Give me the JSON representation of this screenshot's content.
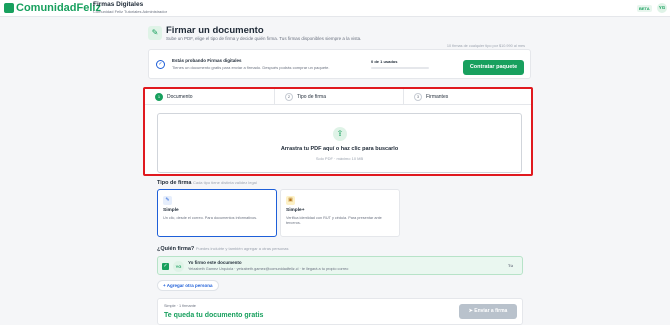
{
  "topbar": {
    "brand": "ComunidadFeliz",
    "app_title": "Firmas Digitales",
    "app_subtitle": "Comunidad Feliz Tutoriales Administrador",
    "badge": "BETA",
    "avatar_initials": "YG"
  },
  "header": {
    "title": "Firmar un documento",
    "subtitle": "Sube un PDF, elige el tipo de firma y decide quién firma. Tus firmas disponibles siempre a la vista."
  },
  "trial": {
    "title": "Estás probando Firmas digitales",
    "subtitle": "Tienes un documento gratis para enviar a firmado. Después podrás comprar un paquete.",
    "count": "0 de 1 usados",
    "progress": 0,
    "note": "10 firmas de cualquier tipo por $10.990 al mes",
    "button": "Contratar paquete"
  },
  "steps": [
    {
      "num": "1",
      "label": "Documento",
      "active": true
    },
    {
      "num": "2",
      "label": "Tipo de firma",
      "active": false
    },
    {
      "num": "3",
      "label": "Firmantes",
      "active": false
    }
  ],
  "dropzone": {
    "title": "Arrastra tu PDF aquí o haz clic para buscarlo",
    "subtitle": "Solo PDF · máximo 10 MB"
  },
  "signature_type": {
    "label": "Tipo de firma",
    "hint": "Cada tipo tiene distinta validez legal",
    "options": [
      {
        "title": "Simple",
        "desc": "Un clic, desde el correo. Para documentos informativos."
      },
      {
        "title": "Simple+",
        "desc": "Verifica identidad con RUT y cédula. Para presentar ante terceros."
      }
    ]
  },
  "signers": {
    "label": "¿Quién firma?",
    "hint": "Puedes incluirte y también agregar a otras personas",
    "me": {
      "initials": "YG",
      "name": "Yo firmo este documento",
      "email": "Yetzabeth Gamez Urquiola · yetzabeth.gamez@comunidadfeliz.cl · te llegará a tu propio correo",
      "tag": "Tú"
    },
    "add_button": "Agregar otra persona"
  },
  "footer": {
    "meta": "Simple · 1 firmante",
    "title": "Te queda tu documento gratis",
    "button": "Enviar a firma"
  }
}
